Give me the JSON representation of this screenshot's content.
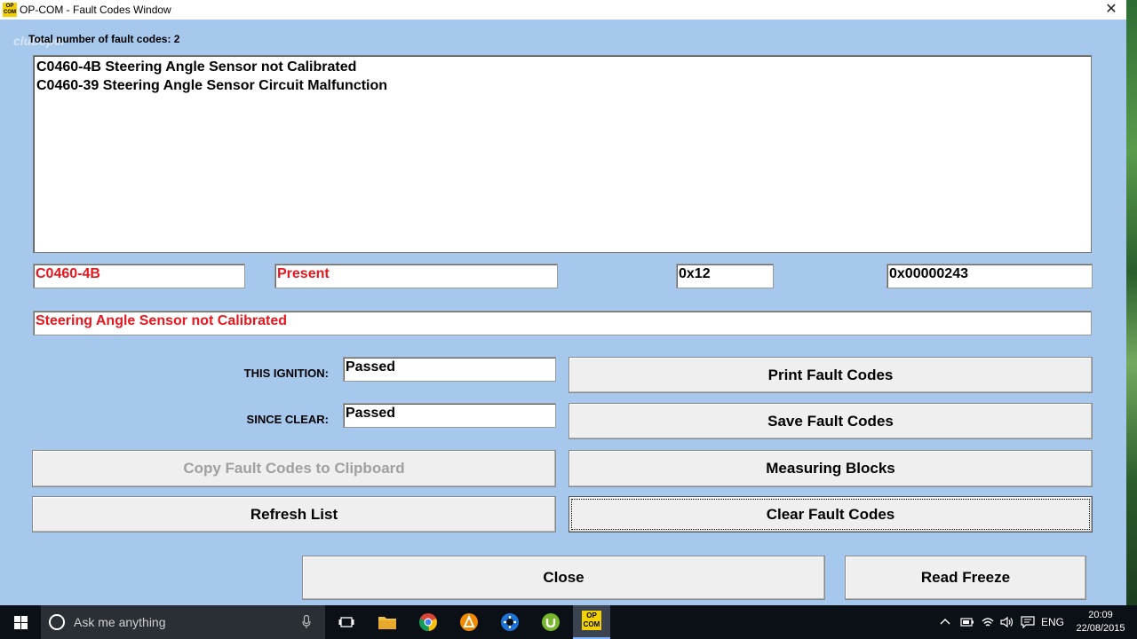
{
  "window": {
    "title": "OP-COM - Fault Codes Window",
    "app_icon_text": "OP COM",
    "close_glyph": "✕"
  },
  "watermark": "clubopel",
  "total": {
    "label": "Total number of fault codes:  2"
  },
  "fault_list": [
    "C0460-4B Steering Angle Sensor not Calibrated",
    "C0460-39 Steering Angle Sensor Circuit Malfunction"
  ],
  "selected": {
    "code": "C0460-4B",
    "status": "Present",
    "hex1": "0x12",
    "hex2": "0x00000243",
    "description": "Steering Angle Sensor not Calibrated"
  },
  "tests": {
    "this_ignition_label": "THIS IGNITION:",
    "this_ignition_value": "Passed",
    "since_clear_label": "SINCE CLEAR:",
    "since_clear_value": "Passed"
  },
  "buttons": {
    "print": "Print Fault Codes",
    "save": "Save Fault Codes",
    "copy": "Copy Fault Codes to Clipboard",
    "measuring": "Measuring Blocks",
    "refresh": "Refresh List",
    "clear": "Clear Fault Codes",
    "close": "Close",
    "freeze": "Read Freeze"
  },
  "taskbar": {
    "search_placeholder": "Ask me anything",
    "opcom_label": "OP COM",
    "language": "ENG",
    "time": "20:09",
    "date": "22/08/2015"
  },
  "colors": {
    "window_bg": "#a6c8ec",
    "error_text": "#e8161e",
    "taskbar_bg": "#0b0f16"
  }
}
